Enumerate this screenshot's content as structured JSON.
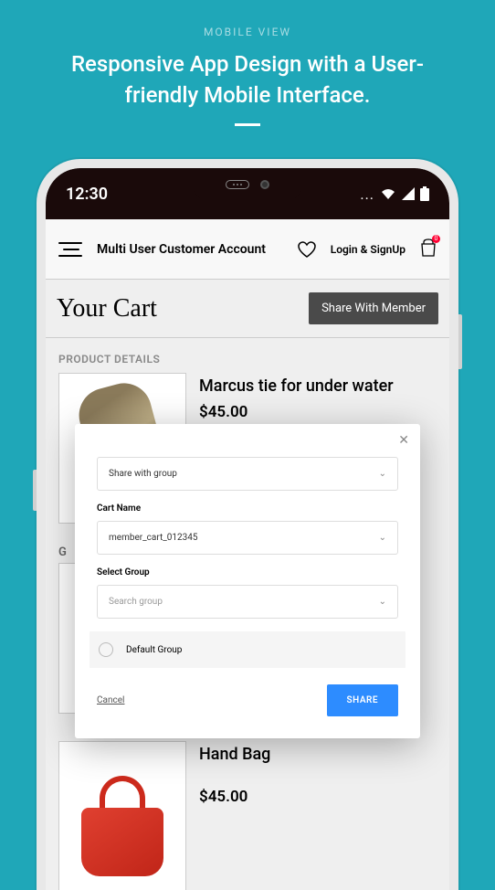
{
  "promo": {
    "label": "MOBILE VIEW",
    "title": "Responsive App Design with a User-friendly Mobile Interface."
  },
  "statusbar": {
    "time": "12:30"
  },
  "header": {
    "title": "Multi User Customer Account",
    "login": "Login & SignUp",
    "badge": "0"
  },
  "cart": {
    "title": "Your Cart",
    "share_btn": "Share  With Member",
    "section_label": "PRODUCT DETAILS",
    "gap_label": "G"
  },
  "products": [
    {
      "name": "Marcus tie for under water",
      "price": "$45.00"
    },
    {
      "name": "",
      "price": ""
    },
    {
      "name": "Hand Bag",
      "price": "$45.00"
    }
  ],
  "modal": {
    "share_with_group": "Share with group",
    "cart_name_label": "Cart Name",
    "cart_name_value": "member_cart_012345",
    "select_group_label": "Select Group",
    "search_placeholder": "Search group",
    "default_group": "Default Group",
    "cancel": "Cancel",
    "share": "SHARE"
  }
}
